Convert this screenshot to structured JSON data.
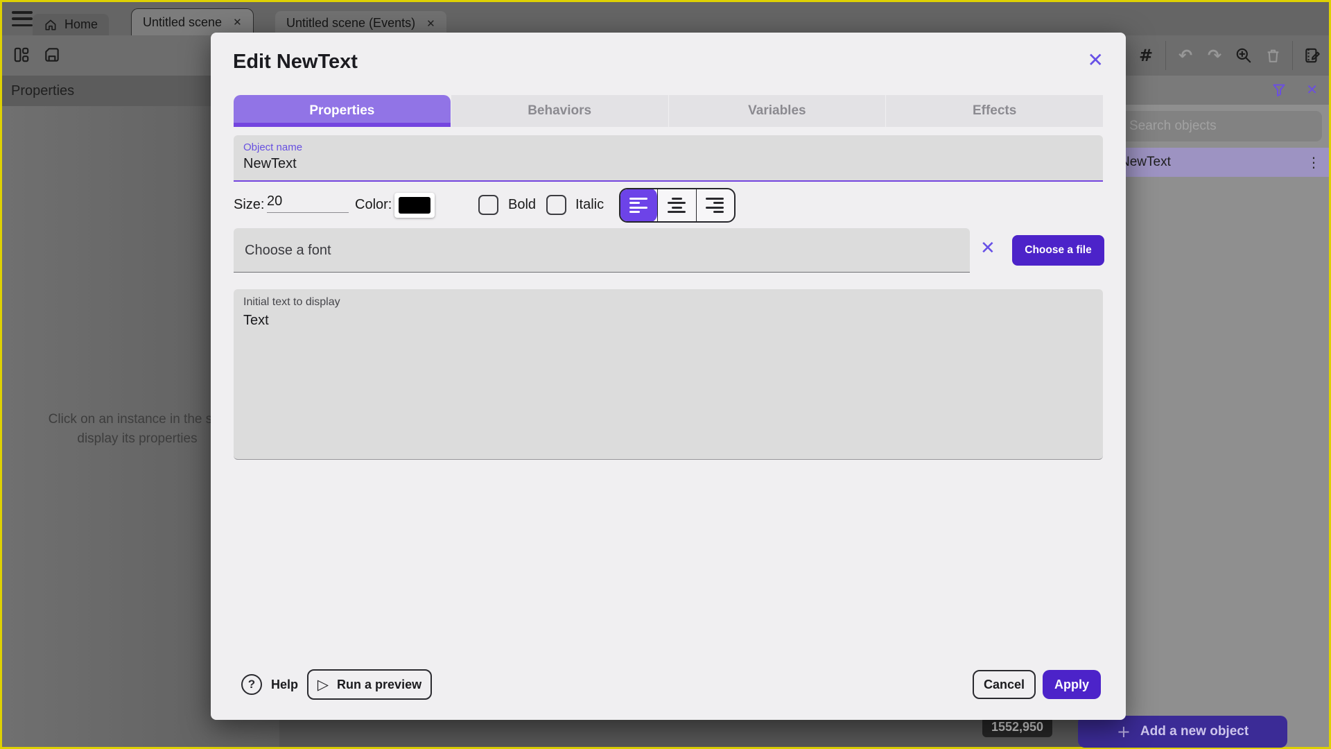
{
  "colors": {
    "frame_border": "#ded103",
    "accent": "#7445df",
    "accent_light": "#9174e6",
    "accent_dark": "#4c23c9",
    "selection_row": "#9d93c2"
  },
  "window": {
    "tabs": [
      {
        "label": "Home"
      },
      {
        "label": "Untitled scene"
      },
      {
        "label": "Untitled scene (Events)"
      }
    ]
  },
  "icons": {
    "close": "✕",
    "kebab": "⋮",
    "undo": "↶",
    "redo": "↷",
    "grid": "#",
    "play": "▷",
    "plus": "+",
    "help": "?"
  },
  "left_panel": {
    "header": "Properties",
    "message_line1": "Click on an instance in the sce",
    "message_line2": "display its properties"
  },
  "canvas": {
    "coords_badge": "1552,950"
  },
  "right_panel": {
    "search_placeholder": "Search objects",
    "object_name": "NewText",
    "add_button_label": "Add a new object"
  },
  "modal": {
    "title": "Edit NewText",
    "tabs": [
      {
        "label": "Properties"
      },
      {
        "label": "Behaviors"
      },
      {
        "label": "Variables"
      },
      {
        "label": "Effects"
      }
    ],
    "object_name": {
      "label": "Object name",
      "value": "NewText"
    },
    "size": {
      "label": "Size:",
      "value": "20"
    },
    "color_label": "Color:",
    "bold_label": "Bold",
    "italic_label": "Italic",
    "font": {
      "placeholder": "Choose a font",
      "choose_file_label": "Choose a file"
    },
    "initial_text": {
      "label": "Initial text to display",
      "value": "Text"
    },
    "footer": {
      "help_label": "Help",
      "run_preview_label": "Run a preview",
      "cancel_label": "Cancel",
      "apply_label": "Apply"
    }
  }
}
